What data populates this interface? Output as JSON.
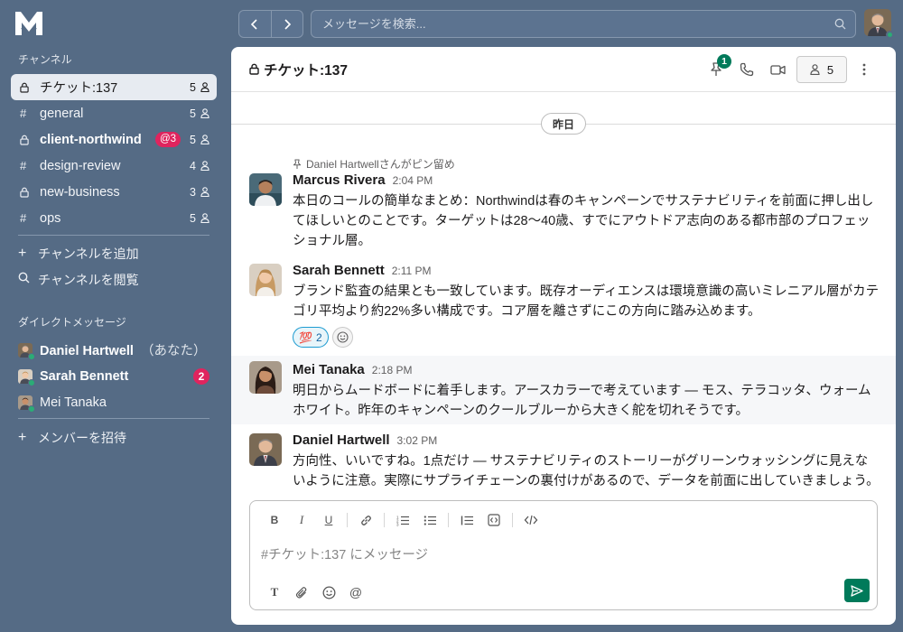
{
  "sidebar": {
    "channels_heading": "チャンネル",
    "channels": [
      {
        "prefix": "lock",
        "name": "チケット:137",
        "members": "5",
        "active": true,
        "bold": false,
        "mention": ""
      },
      {
        "prefix": "hash",
        "name": "general",
        "members": "5",
        "active": false,
        "bold": false,
        "mention": ""
      },
      {
        "prefix": "lock",
        "name": "client-northwind",
        "members": "5",
        "active": false,
        "bold": true,
        "mention": "@3"
      },
      {
        "prefix": "hash",
        "name": "design-review",
        "members": "4",
        "active": false,
        "bold": false,
        "mention": ""
      },
      {
        "prefix": "lock",
        "name": "new-business",
        "members": "3",
        "active": false,
        "bold": false,
        "mention": ""
      },
      {
        "prefix": "hash",
        "name": "ops",
        "members": "5",
        "active": false,
        "bold": false,
        "mention": ""
      }
    ],
    "add_channel": "チャンネルを追加",
    "browse_channels": "チャンネルを閲覧",
    "dm_heading": "ダイレクトメッセージ",
    "dms": [
      {
        "name": "Daniel Hartwell",
        "suffix": "（あなた）",
        "bold": true,
        "badge": ""
      },
      {
        "name": "Sarah Bennett",
        "suffix": "",
        "bold": true,
        "badge": "2"
      },
      {
        "name": "Mei Tanaka",
        "suffix": "",
        "bold": false,
        "badge": ""
      }
    ],
    "invite_members": "メンバーを招待"
  },
  "topbar": {
    "search_placeholder": "メッセージを検索..."
  },
  "channel_header": {
    "title": "チケット:137",
    "pin_count": "1",
    "member_count": "5"
  },
  "timeline": {
    "date_label": "昨日",
    "pinned_note": "Daniel Hartwellさんがピン留め",
    "messages": [
      {
        "author": "Marcus Rivera",
        "time": "2:04 PM",
        "text": "本日のコールの簡単なまとめ：Northwindは春のキャンペーンでサステナビリティを前面に押し出してほしいとのことです。ターゲットは28～40歳、すでにアウトドア志向のある都市部のプロフェッショナル層。"
      },
      {
        "author": "Sarah Bennett",
        "time": "2:11 PM",
        "text": "ブランド監査の結果とも一致しています。既存オーディエンスは環境意識の高いミレニアル層がカテゴリ平均より約22%多い構成です。コア層を離さずにこの方向に踏み込めます。",
        "reaction_emoji": "💯",
        "reaction_count": "2"
      },
      {
        "author": "Mei Tanaka",
        "time": "2:18 PM",
        "text": "明日からムードボードに着手します。アースカラーで考えています — モス、テラコッタ、ウォームホワイト。昨年のキャンペーンのクールブルーから大きく舵を切れそうです。"
      },
      {
        "author": "Daniel Hartwell",
        "time": "3:02 PM",
        "text": "方向性、いいですね。1点だけ — サステナビリティのストーリーがグリーンウォッシングに見えないように注意。実際にサプライチェーンの裏付けがあるので、データを前面に出していきましょう。"
      }
    ]
  },
  "composer": {
    "placeholder": "#チケット:137 にメッセージ"
  },
  "colors": {
    "sidebar_bg": "#556b85",
    "accent_green": "#007a5a",
    "mention_red": "#e0245e"
  }
}
